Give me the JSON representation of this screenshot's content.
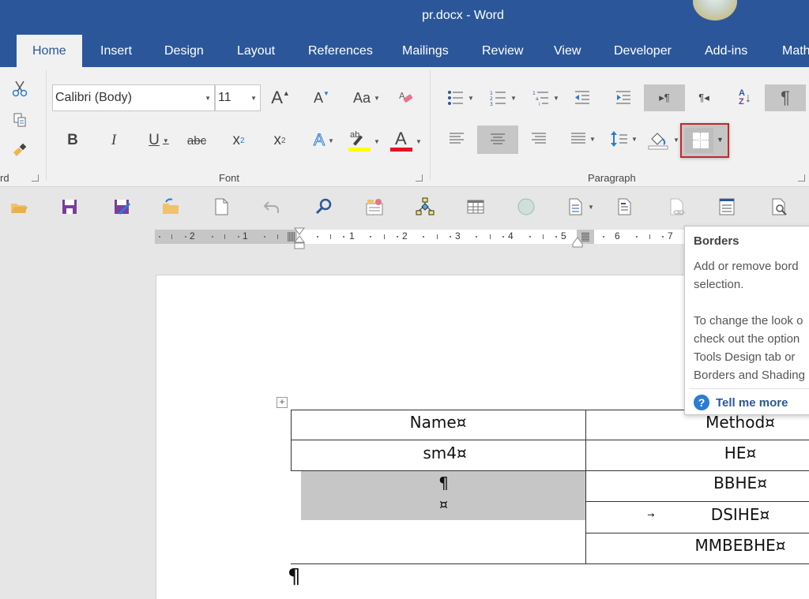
{
  "window": {
    "title": "pr.docx - Word"
  },
  "tabs": [
    {
      "label": "Home",
      "active": true
    },
    {
      "label": "Insert"
    },
    {
      "label": "Design"
    },
    {
      "label": "Layout"
    },
    {
      "label": "References"
    },
    {
      "label": "Mailings"
    },
    {
      "label": "Review"
    },
    {
      "label": "View"
    },
    {
      "label": "Developer"
    },
    {
      "label": "Add-ins"
    },
    {
      "label": "Math"
    }
  ],
  "ribbon": {
    "clipboard": {
      "label_partial": "rd",
      "icons": [
        "cut-icon",
        "copy-icon",
        "format-painter-icon"
      ]
    },
    "font": {
      "label": "Font",
      "font_name": "Calibri (Body)",
      "font_size": "11",
      "grow_font": "A",
      "shrink_font": "A",
      "change_case": "Aa",
      "bold": "B",
      "italic": "I",
      "underline": "U",
      "strikethrough": "abc",
      "subscript": "x",
      "subscript_mark": "2",
      "superscript": "x",
      "superscript_mark": "2",
      "text_effects": "A",
      "highlight": "ab",
      "font_color": "A",
      "highlight_color": "#ffff00",
      "font_color_value": "#e81123"
    },
    "paragraph": {
      "label": "Paragraph",
      "ltr": "▸¶",
      "rtl": "¶◂",
      "sort_a": "A",
      "sort_z": "Z",
      "show_marks": "¶",
      "active_alignment": "center",
      "highlighted_button": "borders"
    }
  },
  "quick_access": [
    "open-folder-icon",
    "save-icon",
    "save-as-icon",
    "move-folder-icon",
    "new-document-icon",
    "undo-icon",
    "find-icon",
    "checklist-icon",
    "org-chart-icon",
    "table-icon",
    "shape-circle-icon",
    "document-dropdown-icon",
    "document-icon",
    "linked-document-icon",
    "form-icon",
    "print-preview-icon"
  ],
  "ruler": {
    "left_numbers": [
      "2",
      "1"
    ],
    "right_numbers": [
      "1",
      "2",
      "3",
      "4",
      "5",
      "6",
      "7"
    ]
  },
  "tooltip": {
    "title": "Borders",
    "lines": [
      "Add or remove borders from your",
      "selection.",
      "",
      "To change the look of your table,",
      "check out the options on the Table",
      "Tools Design tab or in the",
      "Borders and Shading dialog."
    ],
    "visible_lines": [
      "Add or remove bord",
      "selection.",
      "To change the look o",
      "check out the option",
      "Tools Design tab or",
      "Borders and Shading"
    ],
    "help_link": "Tell me more",
    "help_icon": "?"
  },
  "document": {
    "table": {
      "headers": [
        "Name¤",
        "Method¤"
      ],
      "name_column": [
        "sm4¤",
        "¶",
        "¤"
      ],
      "method_column": [
        "HE¤",
        "BBHE¤",
        "DSIHE¤",
        "MMBEBHE¤"
      ],
      "tab_marker": "→"
    },
    "trailing_paragraph_mark": "¶",
    "move_handle": "+"
  }
}
